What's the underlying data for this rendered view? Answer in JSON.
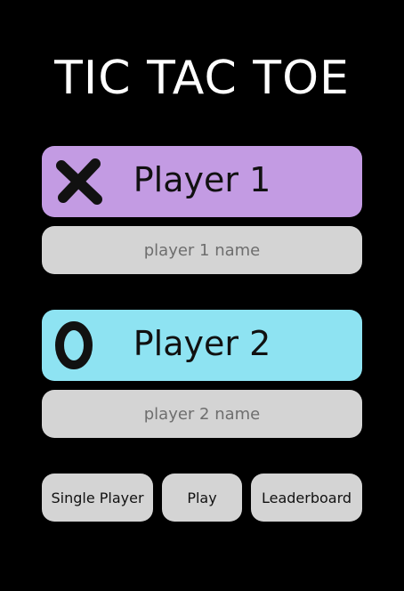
{
  "app": {
    "title": "TIC TAC TOE"
  },
  "players": [
    {
      "label": "Player 1",
      "symbol": "x-mark-icon",
      "color": "#c39be3",
      "name_placeholder": "player 1 name",
      "name_value": ""
    },
    {
      "label": "Player 2",
      "symbol": "o-mark-icon",
      "color": "#8ee3f2",
      "name_placeholder": "player 2 name",
      "name_value": ""
    }
  ],
  "actions": {
    "single_player_label": "Single Player",
    "play_label": "Play",
    "leaderboard_label": "Leaderboard"
  },
  "colors": {
    "background": "#000000",
    "field": "#d4d4d4",
    "text": "#111111"
  }
}
